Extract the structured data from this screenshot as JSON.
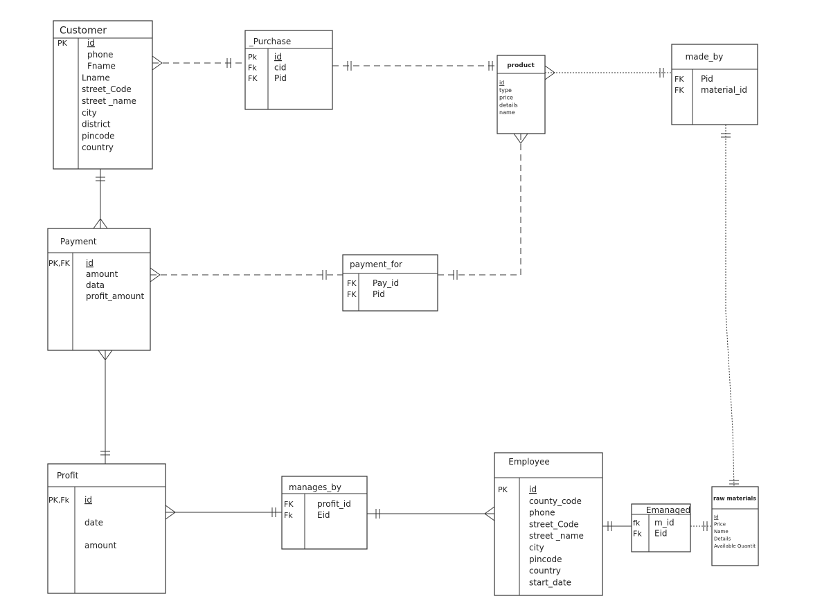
{
  "entities": [
    {
      "id": "customer",
      "title": "Customer",
      "keys": [
        "PK"
      ],
      "attributes": [
        "id",
        "phone",
        "Fname",
        "Lname",
        "street_Code",
        "street _name",
        "city",
        "district",
        "pincode",
        "country"
      ],
      "underlined": [
        "id"
      ]
    },
    {
      "id": "purchase",
      "title": "_Purchase",
      "keys": [
        "Pk",
        "Fk",
        "FK"
      ],
      "attributes": [
        "id",
        "cid",
        "Pid"
      ],
      "underlined": [
        "id"
      ]
    },
    {
      "id": "product",
      "title": "product",
      "keys": [],
      "attributes": [
        "id",
        "type",
        "price",
        "details",
        "name"
      ],
      "underlined": [
        "id"
      ]
    },
    {
      "id": "made_by",
      "title": "made_by",
      "keys": [
        "FK",
        "FK"
      ],
      "attributes": [
        "Pid",
        "material_id"
      ],
      "underlined": []
    },
    {
      "id": "payment",
      "title": "Payment",
      "keys": [
        "PK,FK"
      ],
      "attributes": [
        "id",
        "amount",
        "data",
        "profit_amount"
      ],
      "underlined": [
        "id"
      ]
    },
    {
      "id": "payment_for",
      "title": "payment_for",
      "keys": [
        "FK",
        "FK"
      ],
      "attributes": [
        "Pay_id",
        "Pid"
      ],
      "underlined": []
    },
    {
      "id": "profit",
      "title": "Profit",
      "keys": [
        "PK,Fk"
      ],
      "attributes": [
        "id",
        "date",
        "amount"
      ],
      "underlined": [
        "id"
      ]
    },
    {
      "id": "manages_by",
      "title": "manages_by",
      "keys": [
        "FK",
        "Fk"
      ],
      "attributes": [
        "profit_id",
        "Eid"
      ],
      "underlined": []
    },
    {
      "id": "employee",
      "title": "Employee",
      "keys": [
        "PK"
      ],
      "attributes": [
        "id",
        "county_code",
        "phone",
        "street_Code",
        "street _name",
        "city",
        "pincode",
        "country",
        "start_date"
      ],
      "underlined": [
        "id"
      ]
    },
    {
      "id": "emanaged",
      "title": "Emanaged",
      "keys": [
        "fk",
        "Fk"
      ],
      "attributes": [
        "m_id",
        "Eid"
      ],
      "underlined": []
    },
    {
      "id": "raw_materials",
      "title": "raw materials",
      "keys": [],
      "attributes": [
        "Id",
        "Price",
        "Name",
        "Details",
        "Available Quantit"
      ],
      "underlined": [
        "Id"
      ]
    }
  ],
  "relationships": [
    {
      "from": "customer",
      "to": "purchase",
      "from_end": "many",
      "to_end": "one",
      "style": "dashed"
    },
    {
      "from": "purchase",
      "to": "product",
      "from_end": "one",
      "to_end": "one",
      "style": "dashed"
    },
    {
      "from": "product",
      "to": "made_by",
      "from_end": "many",
      "to_end": "one",
      "style": "dotted"
    },
    {
      "from": "made_by",
      "to": "raw_materials",
      "from_end": "one",
      "to_end": "one",
      "style": "dotted"
    },
    {
      "from": "product",
      "to": "payment_for",
      "from_end": "many",
      "to_end": "one",
      "style": "dashed"
    },
    {
      "from": "payment",
      "to": "payment_for",
      "from_end": "many",
      "to_end": "one",
      "style": "dashed"
    },
    {
      "from": "customer",
      "to": "payment",
      "from_end": "one",
      "to_end": "many",
      "style": "solid"
    },
    {
      "from": "payment",
      "to": "profit",
      "from_end": "many",
      "to_end": "one",
      "style": "solid"
    },
    {
      "from": "profit",
      "to": "manages_by",
      "from_end": "many",
      "to_end": "one",
      "style": "solid"
    },
    {
      "from": "manages_by",
      "to": "employee",
      "from_end": "one",
      "to_end": "many",
      "style": "solid"
    },
    {
      "from": "employee",
      "to": "emanaged",
      "from_end": "one",
      "to_end": "one",
      "style": "solid"
    },
    {
      "from": "emanaged",
      "to": "raw_materials",
      "from_end": "one",
      "to_end": "many",
      "style": "dotted"
    }
  ]
}
